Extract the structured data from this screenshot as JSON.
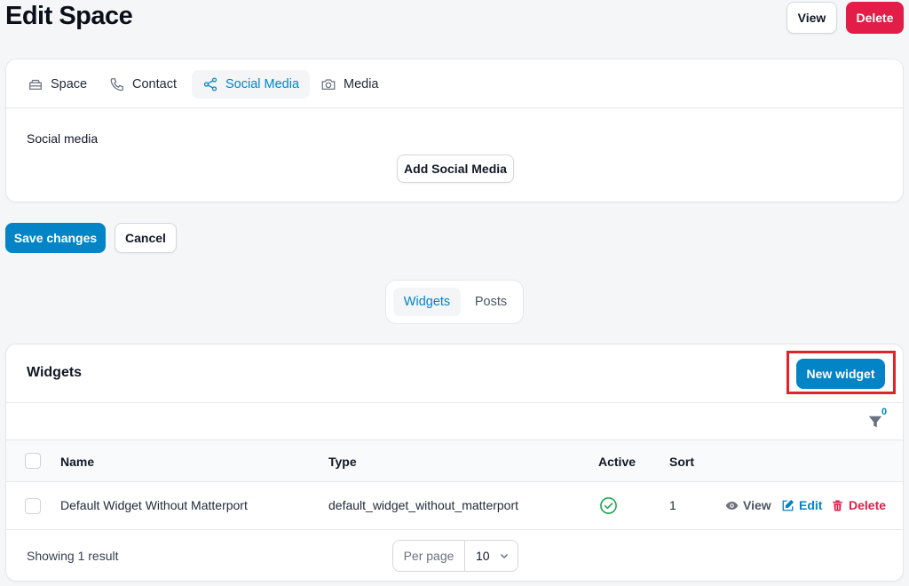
{
  "page": {
    "title": "Edit Space"
  },
  "header_actions": {
    "view_label": "View",
    "delete_label": "Delete"
  },
  "form": {
    "tabs": [
      {
        "label": "Space",
        "icon": "space-icon"
      },
      {
        "label": "Contact",
        "icon": "phone-icon"
      },
      {
        "label": "Social Media",
        "icon": "share-icon",
        "active": true
      },
      {
        "label": "Media",
        "icon": "camera-icon"
      }
    ],
    "field_label": "Social media",
    "add_label": "Add Social Media"
  },
  "form_actions": {
    "save_label": "Save changes",
    "cancel_label": "Cancel"
  },
  "switcher": {
    "items": [
      {
        "label": "Widgets",
        "active": true
      },
      {
        "label": "Posts"
      }
    ]
  },
  "widgets": {
    "title": "Widgets",
    "new_label": "New widget",
    "filter_count": "0",
    "columns": {
      "name": "Name",
      "type": "Type",
      "active": "Active",
      "sort": "Sort"
    },
    "rows": [
      {
        "name": "Default Widget Without Matterport",
        "type": "default_widget_without_matterport",
        "active": true,
        "sort": "1",
        "actions": {
          "view": "View",
          "edit": "Edit",
          "delete": "Delete"
        }
      }
    ],
    "footer": {
      "showing": "Showing 1 result",
      "per_page_label": "Per page",
      "per_page_value": "10"
    }
  },
  "colors": {
    "primary": "#0284c7",
    "danger": "#e11d48",
    "success": "#16a34a",
    "highlight": "#e02424"
  }
}
